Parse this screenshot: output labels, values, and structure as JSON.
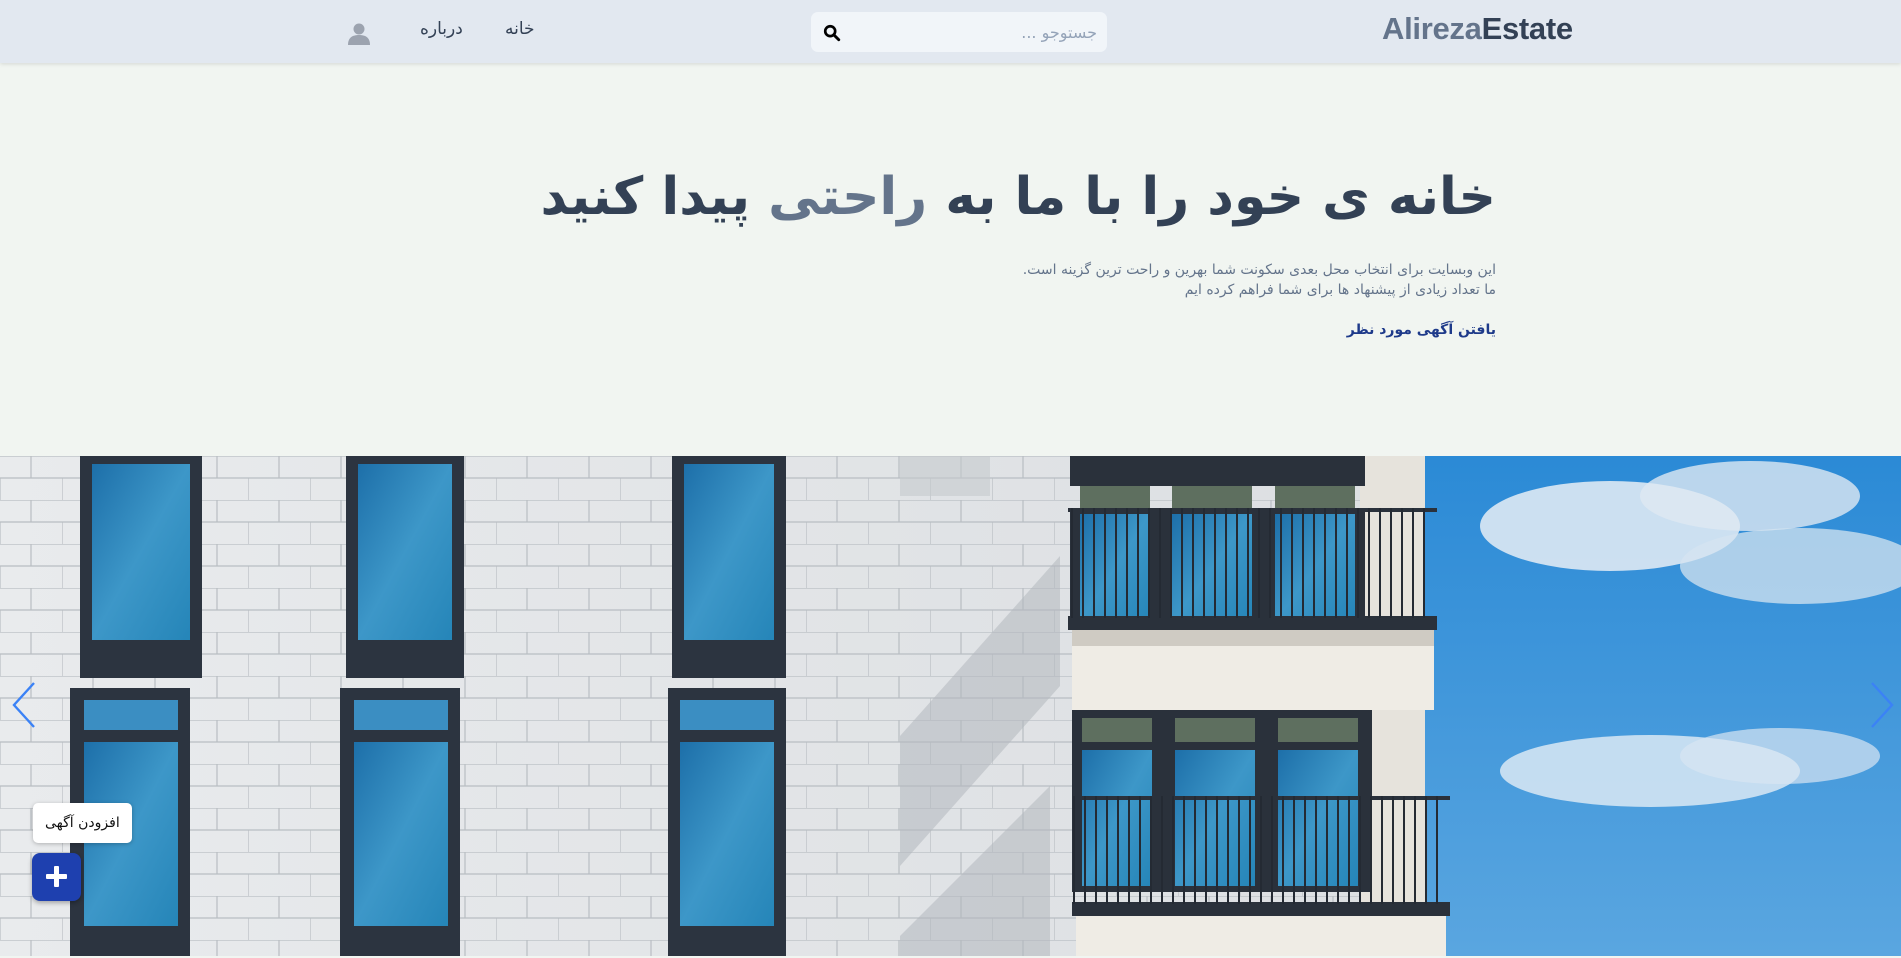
{
  "header": {
    "logo_part1": "Alireza",
    "logo_part2": "Estate",
    "search_placeholder": "جستوجو ...",
    "search_icon": "search-icon",
    "nav": {
      "home": "خانه",
      "about": "درباره"
    },
    "avatar_icon": "user-icon"
  },
  "hero": {
    "title_before": "خانه ی خود را با ما به ",
    "title_accent": "راحتی",
    "title_after": " پیدا کنید",
    "desc_line1": "این وبسایت برای انتخاب محل بعدی سکونت شما بهرین و راحت ترین گزینه است.",
    "desc_line2": "ما تعداد زیادی از پیشنهاد ها برای شما فراهم کرده ایم",
    "cta": "یافتن آگهی مورد نظر"
  },
  "carousel": {
    "prev_icon": "chevron-left-icon",
    "next_icon": "chevron-right-icon"
  },
  "fab": {
    "tooltip": "افزودن آگهی",
    "icon": "plus-icon"
  },
  "colors": {
    "header_bg": "#e2e8f0",
    "page_bg": "#f1f5f1",
    "logo_light": "#64748b",
    "logo_dark": "#334155",
    "cta": "#1e3a8a",
    "fab": "#1e40af",
    "arrow": "#3b82f6"
  }
}
